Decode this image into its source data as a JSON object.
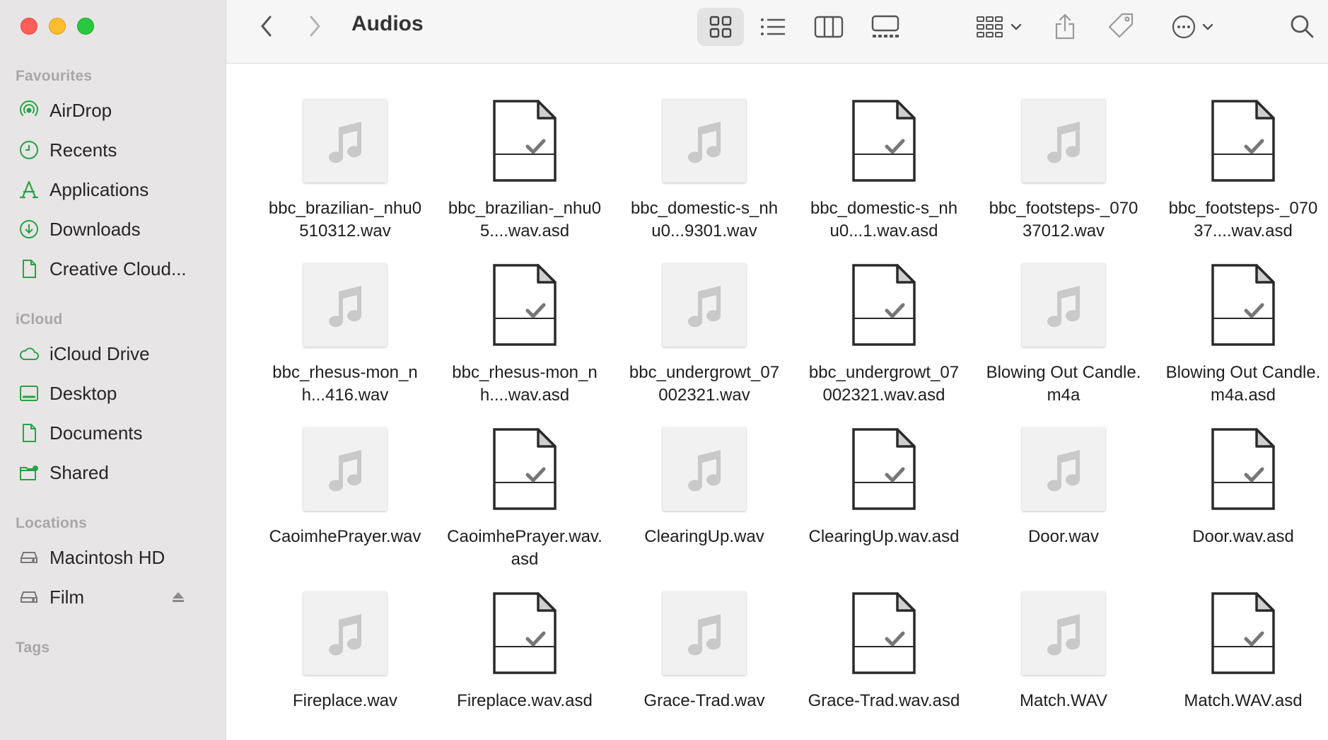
{
  "window": {
    "title": "Audios"
  },
  "sidebar": {
    "favourites_header": "Favourites",
    "favourites": [
      {
        "label": "AirDrop",
        "icon": "airdrop-icon"
      },
      {
        "label": "Recents",
        "icon": "clock-icon"
      },
      {
        "label": "Applications",
        "icon": "applications-icon"
      },
      {
        "label": "Downloads",
        "icon": "download-icon"
      },
      {
        "label": "Creative Cloud...",
        "icon": "document-icon"
      }
    ],
    "icloud_header": "iCloud",
    "icloud": [
      {
        "label": "iCloud Drive",
        "icon": "cloud-icon"
      },
      {
        "label": "Desktop",
        "icon": "desktop-icon"
      },
      {
        "label": "Documents",
        "icon": "document-icon"
      },
      {
        "label": "Shared",
        "icon": "shared-folder-icon"
      }
    ],
    "locations_header": "Locations",
    "locations": [
      {
        "label": "Macintosh HD",
        "icon": "disk-icon"
      },
      {
        "label": "Film",
        "icon": "disk-icon",
        "eject": "eject-icon"
      }
    ],
    "tags_header": "Tags"
  },
  "toolbar": {
    "back": "chevron-left-icon",
    "forward": "chevron-right-icon",
    "views": [
      "icon-view-icon",
      "list-view-icon",
      "column-view-icon",
      "gallery-view-icon"
    ],
    "selected_view": "icon-view-icon",
    "group": "group-icon",
    "share": "share-icon",
    "tag": "tag-icon",
    "more": "more-icon",
    "search": "search-icon"
  },
  "files": [
    {
      "name": "bbc_brazilian-_nhu0510312.wav",
      "type": "audio"
    },
    {
      "name": "bbc_brazilian-_nhu05....wav.asd",
      "type": "doc"
    },
    {
      "name": "bbc_domestic-s_nhu0...9301.wav",
      "type": "audio"
    },
    {
      "name": "bbc_domestic-s_nhu0...1.wav.asd",
      "type": "doc"
    },
    {
      "name": "bbc_footsteps-_07037012.wav",
      "type": "audio"
    },
    {
      "name": "bbc_footsteps-_07037....wav.asd",
      "type": "doc"
    },
    {
      "name": "bbc_rhesus-mon_nh...416.wav",
      "type": "audio"
    },
    {
      "name": "bbc_rhesus-mon_nh....wav.asd",
      "type": "doc"
    },
    {
      "name": "bbc_undergrowt_07002321.wav",
      "type": "audio"
    },
    {
      "name": "bbc_undergrowt_07002321.wav.asd",
      "type": "doc"
    },
    {
      "name": "Blowing Out Candle.m4a",
      "type": "audio"
    },
    {
      "name": "Blowing Out Candle.m4a.asd",
      "type": "doc"
    },
    {
      "name": "CaoimhePrayer.wav",
      "type": "audio"
    },
    {
      "name": "CaoimhePrayer.wav.asd",
      "type": "doc"
    },
    {
      "name": "ClearingUp.wav",
      "type": "audio"
    },
    {
      "name": "ClearingUp.wav.asd",
      "type": "doc"
    },
    {
      "name": "Door.wav",
      "type": "audio"
    },
    {
      "name": "Door.wav.asd",
      "type": "doc"
    },
    {
      "name": "Fireplace.wav",
      "type": "audio"
    },
    {
      "name": "Fireplace.wav.asd",
      "type": "doc"
    },
    {
      "name": "Grace-Trad.wav",
      "type": "audio"
    },
    {
      "name": "Grace-Trad.wav.asd",
      "type": "doc"
    },
    {
      "name": "Match.WAV",
      "type": "audio"
    },
    {
      "name": "Match.WAV.asd",
      "type": "doc"
    }
  ]
}
